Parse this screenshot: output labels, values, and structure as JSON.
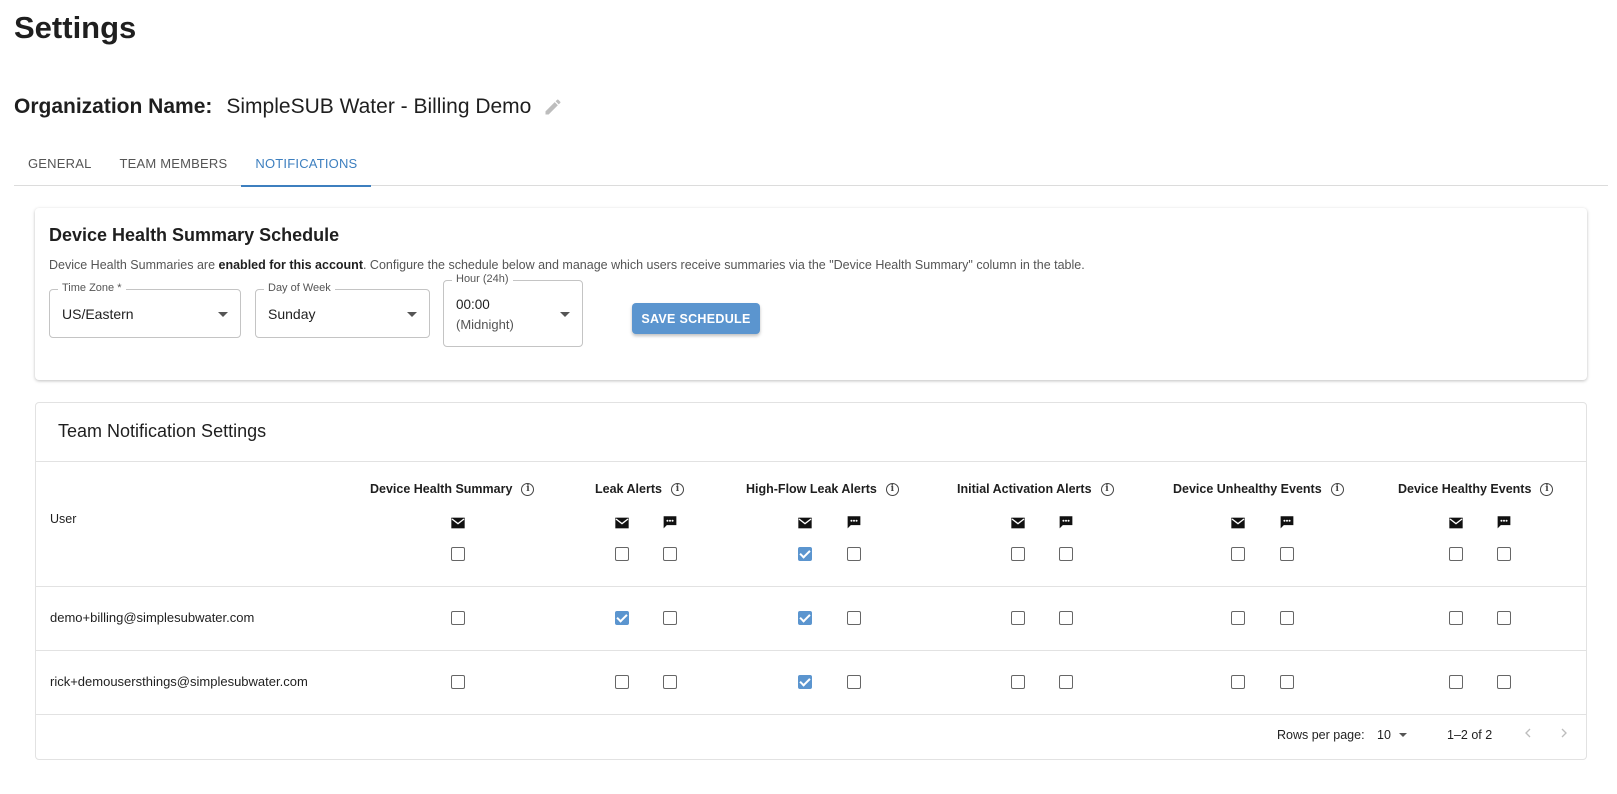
{
  "page": {
    "title": "Settings"
  },
  "organization": {
    "label": "Organization Name:",
    "name": "SimpleSUB Water - Billing Demo"
  },
  "tabs": [
    {
      "label": "GENERAL",
      "active": false
    },
    {
      "label": "TEAM MEMBERS",
      "active": false
    },
    {
      "label": "NOTIFICATIONS",
      "active": true
    }
  ],
  "schedule": {
    "title": "Device Health Summary Schedule",
    "desc_prefix": "Device Health Summaries are ",
    "desc_bold": "enabled for this account",
    "desc_suffix": ". Configure the schedule below and manage which users receive summaries via the \"Device Health Summary\" column in the table.",
    "timezone": {
      "label": "Time Zone *",
      "value": "US/Eastern"
    },
    "day": {
      "label": "Day of Week",
      "value": "Sunday"
    },
    "hour": {
      "label": "Hour (24h)",
      "value_line1": "00:00",
      "value_line2": "(Midnight)"
    },
    "save_label": "SAVE SCHEDULE"
  },
  "team": {
    "title": "Team Notification Settings",
    "user_header": "User",
    "columns": [
      {
        "label": "Device Health Summary",
        "channels": [
          "email"
        ]
      },
      {
        "label": "Leak Alerts",
        "channels": [
          "email",
          "sms"
        ]
      },
      {
        "label": "High-Flow Leak Alerts",
        "channels": [
          "email",
          "sms"
        ]
      },
      {
        "label": "Initial Activation Alerts",
        "channels": [
          "email",
          "sms"
        ]
      },
      {
        "label": "Device Unhealthy Events",
        "channels": [
          "email",
          "sms"
        ]
      },
      {
        "label": "Device Healthy Events",
        "channels": [
          "email",
          "sms"
        ]
      }
    ],
    "select_all": [
      [
        false
      ],
      [
        false,
        false
      ],
      [
        true,
        false
      ],
      [
        false,
        false
      ],
      [
        false,
        false
      ],
      [
        false,
        false
      ]
    ],
    "rows": [
      {
        "user": "demo+billing@simplesubwater.com",
        "checks": [
          [
            false
          ],
          [
            true,
            false
          ],
          [
            true,
            false
          ],
          [
            false,
            false
          ],
          [
            false,
            false
          ],
          [
            false,
            false
          ]
        ]
      },
      {
        "user": "rick+demousersthings@simplesubwater.com",
        "checks": [
          [
            false
          ],
          [
            false,
            false
          ],
          [
            true,
            false
          ],
          [
            false,
            false
          ],
          [
            false,
            false
          ],
          [
            false,
            false
          ]
        ]
      }
    ],
    "pagination": {
      "rows_per_page_label": "Rows per page:",
      "rows_per_page": "10",
      "range": "1–2 of 2"
    }
  },
  "icons": {
    "edit": "pencil-icon",
    "info": "info-icon",
    "email": "mail-icon",
    "sms": "sms-icon",
    "prev": "chevron-left-icon",
    "next": "chevron-right-icon"
  },
  "colors": {
    "accent": "#3d7fbf",
    "button": "#5b95cf",
    "checked": "#5b95cf"
  }
}
